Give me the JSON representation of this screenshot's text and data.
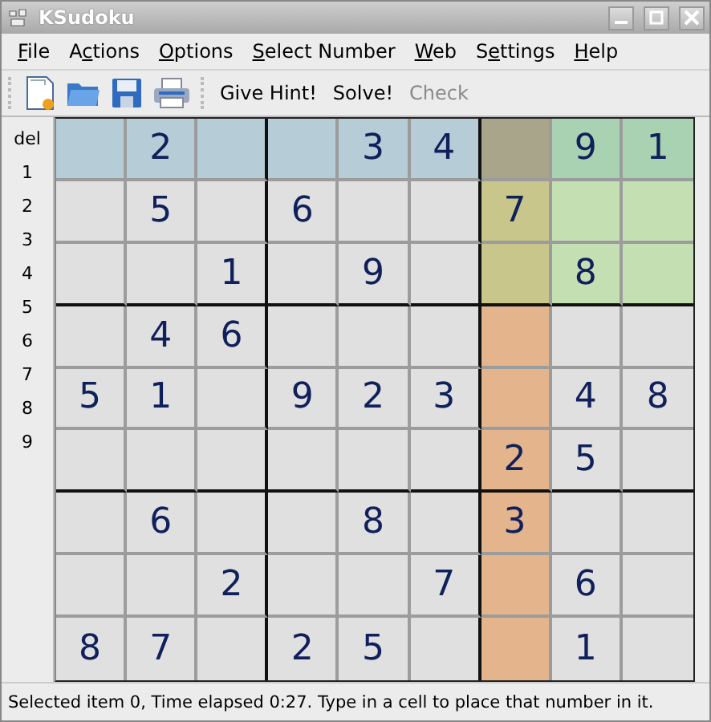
{
  "window": {
    "title": "KSudoku"
  },
  "menu": [
    {
      "key": "F",
      "post": "ile"
    },
    {
      "pre": "A",
      "key": "c",
      "post": "tions"
    },
    {
      "key": "O",
      "post": "ptions"
    },
    {
      "key": "S",
      "post": "elect Number"
    },
    {
      "key": "W",
      "post": "eb"
    },
    {
      "pre": "S",
      "key": "e",
      "post": "ttings"
    },
    {
      "key": "H",
      "post": "elp"
    }
  ],
  "toolbar": {
    "icons": [
      {
        "kind": "new"
      },
      {
        "kind": "open"
      },
      {
        "kind": "save"
      },
      {
        "kind": "print"
      }
    ],
    "actions": [
      {
        "label": "Give Hint!",
        "disabled": false
      },
      {
        "label": "Solve!",
        "disabled": false
      },
      {
        "label": "Check",
        "disabled": true
      }
    ]
  },
  "number_selector": [
    "del",
    "1",
    "2",
    "3",
    "4",
    "5",
    "6",
    "7",
    "8",
    "9"
  ],
  "board": {
    "rows": [
      [
        {},
        {
          "value": "2"
        },
        {},
        {},
        {
          "value": "3"
        },
        {
          "value": "4"
        },
        {
          "selected": true
        },
        {
          "value": "9"
        },
        {
          "value": "1"
        }
      ],
      [
        {},
        {
          "value": "5"
        },
        {},
        {
          "value": "6"
        },
        {},
        {},
        {
          "value": "7"
        },
        {},
        {}
      ],
      [
        {},
        {},
        {
          "value": "1"
        },
        {},
        {
          "value": "9"
        },
        {},
        {},
        {
          "value": "8"
        },
        {}
      ],
      [
        {},
        {
          "value": "4"
        },
        {
          "value": "6"
        },
        {},
        {},
        {},
        {},
        {},
        {}
      ],
      [
        {
          "value": "5"
        },
        {
          "value": "1"
        },
        {},
        {
          "value": "9"
        },
        {
          "value": "2"
        },
        {
          "value": "3"
        },
        {},
        {
          "value": "4"
        },
        {
          "value": "8"
        }
      ],
      [
        {},
        {},
        {},
        {},
        {},
        {},
        {
          "value": "2"
        },
        {
          "value": "5"
        },
        {}
      ],
      [
        {},
        {
          "value": "6"
        },
        {},
        {},
        {
          "value": "8"
        },
        {},
        {
          "value": "3"
        },
        {},
        {}
      ],
      [
        {},
        {},
        {
          "value": "2"
        },
        {},
        {},
        {
          "value": "7"
        },
        {},
        {
          "value": "6"
        },
        {}
      ],
      [
        {
          "value": "8"
        },
        {
          "value": "7"
        },
        {},
        {
          "value": "2"
        },
        {
          "value": "5"
        },
        {},
        {},
        {
          "value": "1"
        },
        {}
      ]
    ]
  },
  "status_bar": "Selected item 0, Time elapsed 0:27. Type in a cell to place that number in it."
}
